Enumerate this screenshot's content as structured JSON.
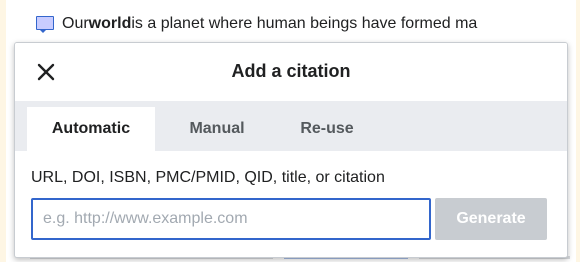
{
  "article": {
    "text_before": "Our ",
    "text_bold": "world",
    "text_after": " is a planet where human beings have formed ma"
  },
  "dialog": {
    "title": "Add a citation",
    "close_icon": "close-icon",
    "tabs": [
      {
        "label": "Automatic",
        "active": true
      },
      {
        "label": "Manual",
        "active": false
      },
      {
        "label": "Re-use",
        "active": false
      }
    ],
    "field_label": "URL, DOI, ISBN, PMC/PMID, QID, title, or citation",
    "input": {
      "value": "",
      "placeholder": "e.g. http://www.example.com"
    },
    "generate_label": "Generate",
    "generate_enabled": false
  },
  "colors": {
    "accent": "#3366cc",
    "disabled_button": "#c8ccd1",
    "tab_bar": "#eaecf0",
    "outer_background": "#fef6e4"
  }
}
